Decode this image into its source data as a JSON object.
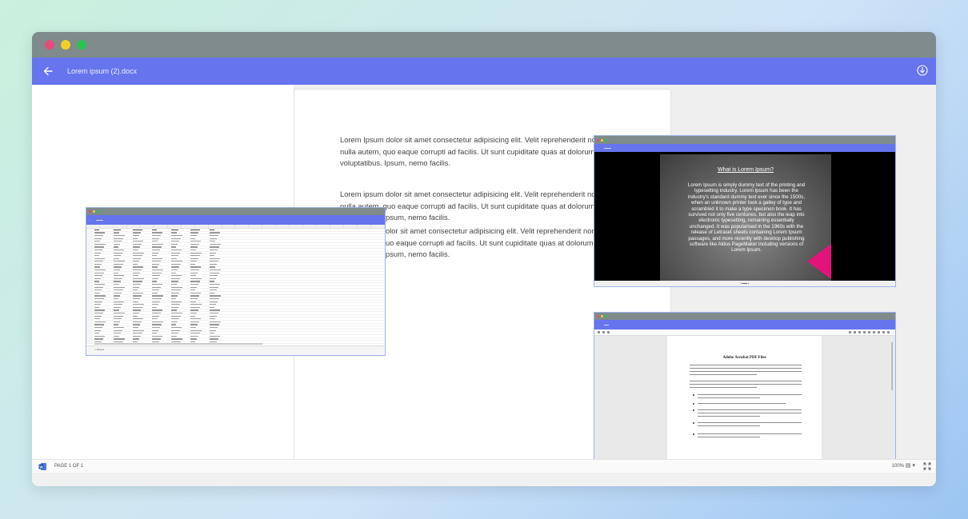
{
  "window": {
    "title": "Lorem ipsum (2).docx"
  },
  "document": {
    "paragraphs": [
      "Lorem Ipsum dolor sit amet consectetur adipisicing elit. Velit reprehenderit non",
      "nulla autem, quo eaque corrupti ad facilis. Ut sunt cupiditate quas at dolorum",
      "voluptatibus. Ipsum, nemo facilis.",
      "Lorem ipsum dolor sit amet consectetur adipisicing elit. Velit reprehenderit non",
      "nulla autem, quo eaque corrupti ad facilis. Ut sunt cupiditate quas at dolorum",
      "psum, nemo facilis.",
      "olor sit amet consectetur adipisicing elit. Velit reprehenderit non",
      "uo eaque corrupti ad facilis. Ut sunt cupiditate quas at dolorum",
      "psum, nemo facilis."
    ]
  },
  "statusbar": {
    "page_label": "PAGE 1 OF 1",
    "zoom": "100%",
    "view_glyph": "▤ ▾"
  },
  "slide": {
    "title": "What is Lorem Ipsum?",
    "body": "Lorem Ipsum is simply dummy text of the printing and typesetting industry. Lorem Ipsum has been the industry's standard dummy text ever since the 1500s, when an unknown printer took a galley of type and scrambled it to make a type specimen book. It has survived not only five centuries, but also the leap into electronic typesetting, remaining essentially unchanged. It was popularised in the 1960s with the release of Letraset sheets containing Lorem Ipsum passages, and more recently with desktop publishing software like Aldus PageMaker including versions of Lorem Ipsum."
  },
  "pdf": {
    "title": "Adobe Acrobat PDF Files"
  },
  "sheet": {
    "tab_label": "Sheet1"
  },
  "colors": {
    "accent": "#6674ee",
    "titlebar": "#7f8b8c",
    "slide_triangle": "#e2147a"
  },
  "icons": {
    "back": "back-arrow-icon",
    "download": "download-icon",
    "word": "word-icon",
    "expand": "expand-icon"
  }
}
